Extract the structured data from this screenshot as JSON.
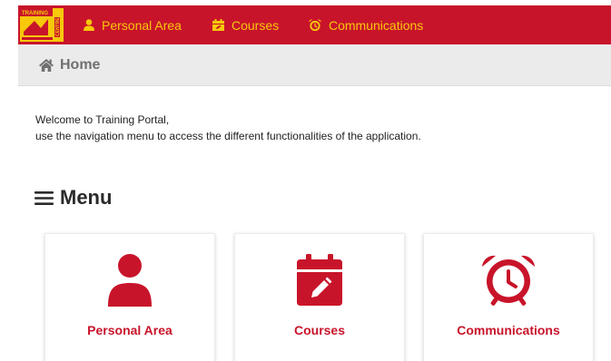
{
  "brand": {
    "logo_text": "TRAINING CENTRE"
  },
  "nav": {
    "items": [
      {
        "label": "Personal Area",
        "icon": "user-icon"
      },
      {
        "label": "Courses",
        "icon": "calendar-icon"
      },
      {
        "label": "Communications",
        "icon": "alarm-clock-icon"
      }
    ]
  },
  "breadcrumb": {
    "home_label": "Home",
    "icon": "home-icon"
  },
  "welcome": {
    "line1": "Welcome to Training Portal,",
    "line2": "use the navigation menu to access the different functionalities of the application."
  },
  "menu": {
    "title": "Menu",
    "cards": [
      {
        "label": "Personal Area",
        "icon": "user-icon"
      },
      {
        "label": "Courses",
        "icon": "calendar-edit-icon"
      },
      {
        "label": "Communications",
        "icon": "alarm-clock-icon"
      }
    ]
  },
  "colors": {
    "primary_red": "#c8142a",
    "nav_yellow": "#f7c80b",
    "breadcrumb_bg": "#ebebeb"
  }
}
